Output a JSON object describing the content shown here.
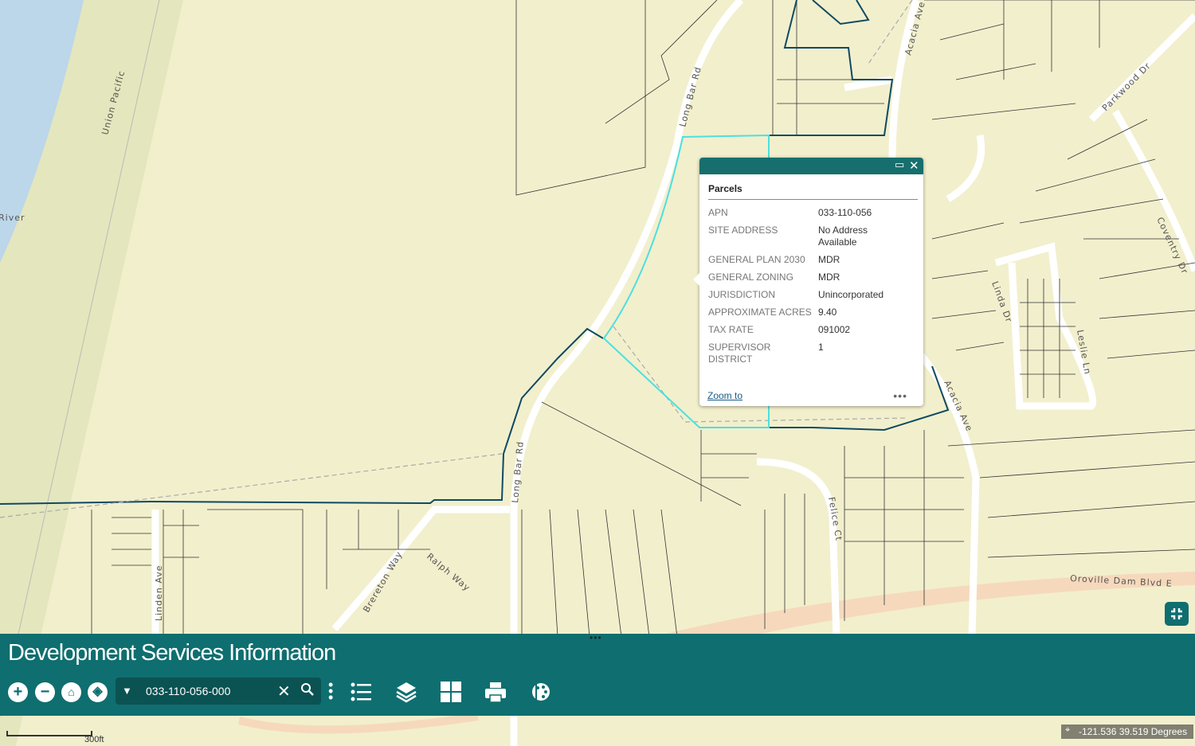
{
  "app": {
    "title": "Development Services Information"
  },
  "map": {
    "street_labels": [
      "Long Bar Rd",
      "Long Bar Rd",
      "Acacia Ave",
      "Acacia Ave",
      "Parkwood Dr",
      "Coventry Dr",
      "Linda Dr",
      "Leslie Ln",
      "Felice Ct",
      "Oroville Dam Blvd E",
      "Linden Ave",
      "Brereton Way",
      "Ralph Way",
      "Union Pacific",
      "River"
    ],
    "colors": {
      "land": "#f2efcd",
      "water": "#bcd6ea",
      "road": "#ffffff",
      "highway": "#f6d9bc",
      "parcel_line": "#333333",
      "boundary": "#0e4a63",
      "selected": "#4be0e0"
    },
    "scale_label": "300ft",
    "coordinates": "-121.536 39.519 Degrees"
  },
  "popup": {
    "title": "Parcels",
    "fields": [
      {
        "label": "APN",
        "value": "033-110-056"
      },
      {
        "label": "SITE ADDRESS",
        "value": "No Address Available"
      },
      {
        "label": "GENERAL PLAN 2030",
        "value": "MDR"
      },
      {
        "label": "GENERAL ZONING",
        "value": "MDR"
      },
      {
        "label": "JURISDICTION",
        "value": "Unincorporated"
      },
      {
        "label": "APPROXIMATE ACRES",
        "value": "9.40"
      },
      {
        "label": "TAX RATE",
        "value": "091002"
      },
      {
        "label": "SUPERVISOR DISTRICT",
        "value": "1"
      }
    ],
    "zoom_link": "Zoom to",
    "more": "•••",
    "icons": [
      "maximize-icon",
      "close-icon"
    ]
  },
  "toolbar": {
    "search_value": "033-110-056-000",
    "nav_icons": [
      "zoom-in-icon",
      "zoom-out-icon",
      "home-icon",
      "locate-icon"
    ],
    "tools": [
      "legend-icon",
      "layers-icon",
      "basemap-gallery-icon",
      "print-icon",
      "palette-icon"
    ]
  }
}
